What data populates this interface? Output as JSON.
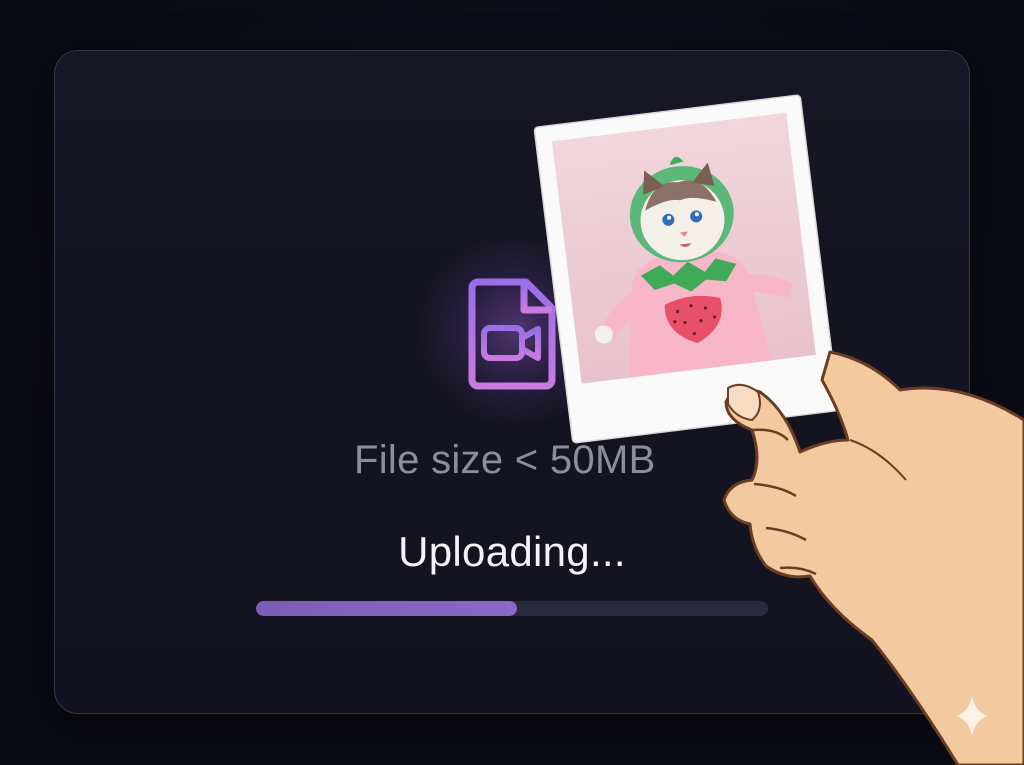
{
  "upload": {
    "file_size_hint": "File size < 50MB",
    "status": "Uploading...",
    "progress": 0.51
  },
  "icons": {
    "file": "video-file-icon",
    "watermark": "sparkle-icon"
  },
  "colors": {
    "background": "#0b0b14",
    "card": "#161624",
    "accent": "#a070e0",
    "progress_fill": "#7b5eb8",
    "progress_track": "#2a2a3e",
    "muted_text": "#8e8e98",
    "status_text": "#f4f4f8"
  }
}
